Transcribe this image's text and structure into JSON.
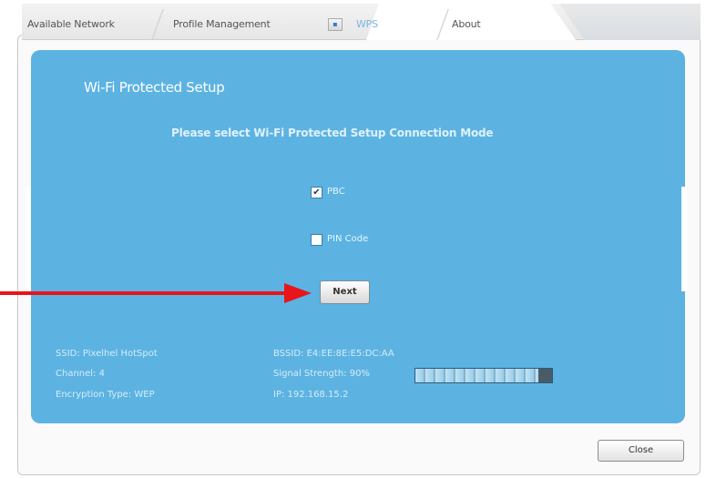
{
  "tabs": [
    {
      "label": "Available Network"
    },
    {
      "label": "Profile Management"
    },
    {
      "label": "WPS"
    },
    {
      "label": "About"
    }
  ],
  "wps": {
    "title": "Wi-Fi Protected Setup",
    "prompt": "Please select Wi-Fi Protected Setup Connection Mode",
    "options": [
      {
        "label": "PBC",
        "checked": true
      },
      {
        "label": "PIN Code",
        "checked": false
      }
    ],
    "next_label": "Next"
  },
  "status": {
    "ssid": "SSID: Pixelhel HotSpot",
    "channel": "Channel: 4",
    "encryption": "Encryption Type: WEP",
    "bssid": "BSSID: E4:EE:8E:E5:DC:AA",
    "signal_text": "Signal Strength: 90%",
    "signal_level": 0.9,
    "ip": "IP: 192.168.15.2"
  },
  "close_label": "Close",
  "colors": {
    "panel": "#5cb3e2",
    "annotation_arrow": "#e8151b"
  }
}
